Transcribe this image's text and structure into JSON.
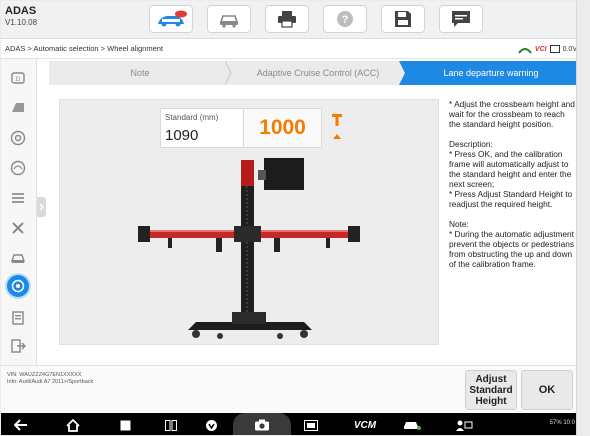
{
  "app": {
    "title": "ADAS",
    "version": "V1.10.08"
  },
  "toolbar": {
    "buttons": [
      {
        "name": "home-autel-button",
        "badge": "NEW"
      },
      {
        "name": "vehicle-connect-button"
      },
      {
        "name": "print-button"
      },
      {
        "name": "help-button"
      },
      {
        "name": "save-button"
      },
      {
        "name": "message-button"
      }
    ]
  },
  "breadcrumb": "ADAS > Automatic selection > Wheel alignment",
  "status": {
    "vci_label": "VCI",
    "voltage": "0.0V"
  },
  "steps": [
    {
      "label": "Note",
      "state": "done"
    },
    {
      "label": "Adaptive Cruise Control (ACC)",
      "state": "done"
    },
    {
      "label": "Lane departure warning",
      "state": "active"
    }
  ],
  "measurement": {
    "standard_label": "Standard (mm)",
    "standard_value": "1090",
    "current_value": "1000",
    "direction": "up"
  },
  "instructions": "* Adjust the crossbeam height and wait for the crossbeam to reach the standard height position.\n\nDescription:\n* Press OK, and the calibration frame will automatically adjust to the standard height and enter the next screen;\n* Press Adjust Standard Height to readjust the required height.\n\nNote:\n* During the automatic adjustment prevent the objects or pedestrians from obstructing the up and down of the calibration frame.",
  "footer": {
    "vin": "VIN: WAUZZZ4G7EN1XXXXX",
    "info": "Info: Audi/Audi A7 2011>/Sportback"
  },
  "buttons": {
    "adjust": "Adjust\nStandard\nHeight",
    "ok": "OK"
  },
  "navbar": {
    "vcm_label": "VCM",
    "system_status": "57% 10:0"
  },
  "colors": {
    "accent": "#1e88e5",
    "current_value": "#f57c00",
    "frame_red": "#c62828"
  }
}
